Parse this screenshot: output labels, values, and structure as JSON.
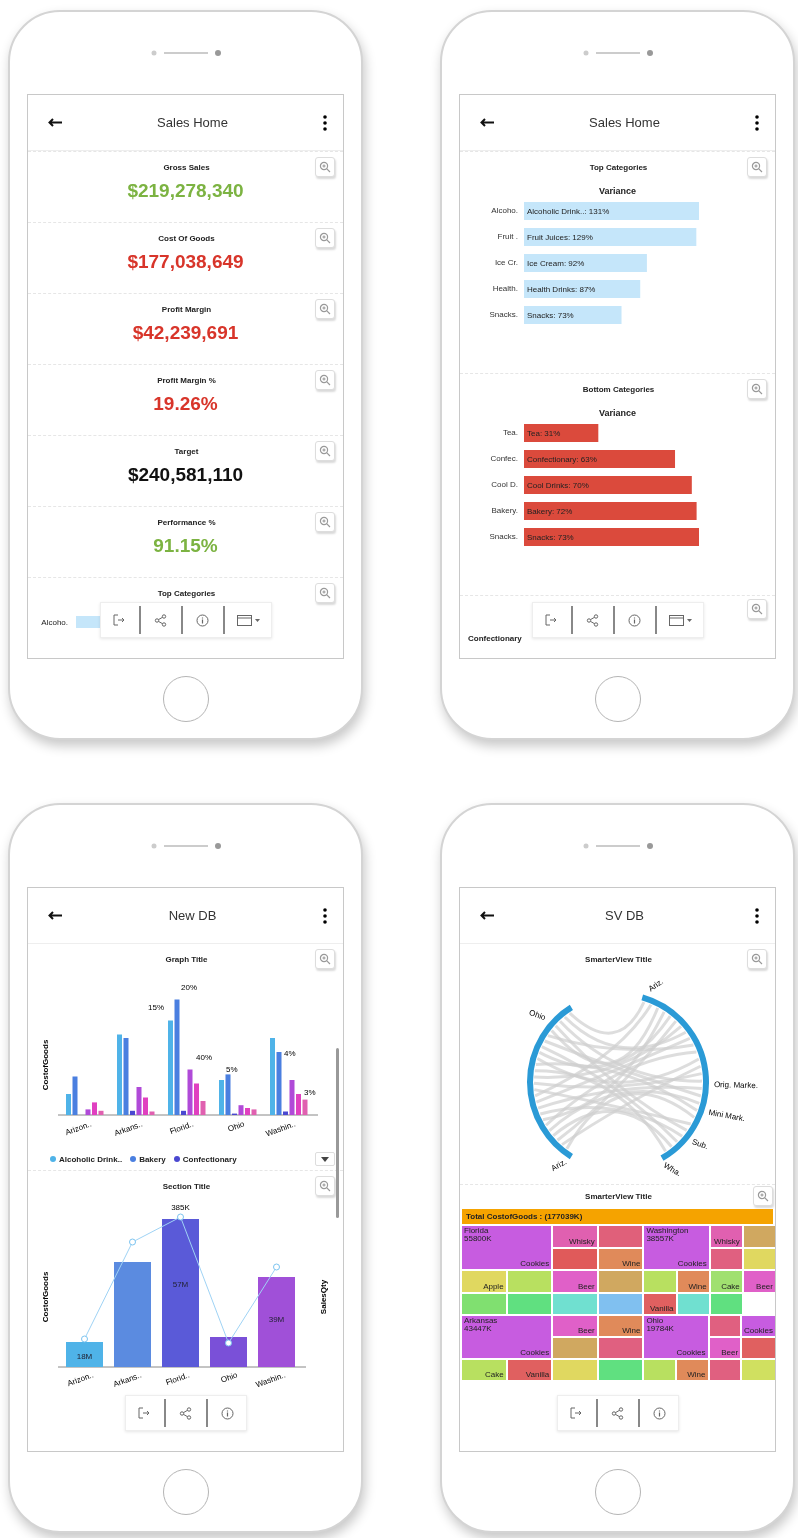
{
  "phones": [
    {
      "title": "Sales Home",
      "panels": [
        {
          "kind": "kpi",
          "label": "Gross Sales",
          "value": "$219,278,340",
          "color": "#7cb342"
        },
        {
          "kind": "kpi",
          "label": "Cost Of Goods",
          "value": "$177,038,649",
          "color": "#d8352a"
        },
        {
          "kind": "kpi",
          "label": "Profit Margin",
          "value": "$42,239,691",
          "color": "#d8352a"
        },
        {
          "kind": "kpi",
          "label": "Profit Margin %",
          "value": "19.26%",
          "color": "#d8352a"
        },
        {
          "kind": "kpi",
          "label": "Target",
          "value": "$240,581,110",
          "color": "#111111"
        },
        {
          "kind": "kpi",
          "label": "Performance %",
          "value": "91.15%",
          "color": "#7cb342"
        },
        {
          "kind": "peek",
          "title": "Top Categories",
          "category": "Alcoho."
        }
      ],
      "toolbar": [
        {
          "kind": "exit"
        },
        {
          "kind": "share"
        },
        {
          "kind": "info"
        },
        {
          "kind": "calendar"
        }
      ]
    },
    {
      "title": "Sales Home",
      "panels": [
        {
          "kind": "hbar",
          "title": "Top Categories",
          "color": "#c5e6fa",
          "chart_data": {
            "type": "bar",
            "orientation": "horizontal",
            "title": "Variance",
            "categories": [
              "Alcoho.",
              "Fruit .",
              "Ice Cr.",
              "Health.",
              "Snacks."
            ],
            "values": [
              131,
              129,
              92,
              87,
              73
            ],
            "value_labels": [
              "Alcoholic Drink..: 131%",
              "Fruit Juices: 129%",
              "Ice Cream: 92%",
              "Health Drinks: 87%",
              "Snacks: 73%"
            ]
          }
        },
        {
          "kind": "hbar",
          "title": "Bottom Categories",
          "color": "#db4a3c",
          "chart_data": {
            "type": "bar",
            "orientation": "horizontal",
            "title": "Variance",
            "categories": [
              "Tea.",
              "Confec.",
              "Cool D.",
              "Bakery.",
              "Snacks."
            ],
            "values": [
              31,
              63,
              70,
              72,
              73
            ],
            "value_labels": [
              "Tea: 31%",
              "Confectionary: 63%",
              "Cool Drinks: 70%",
              "Bakery: 72%",
              "Snacks: 73%"
            ]
          }
        },
        {
          "kind": "heading",
          "title": "Confectionary"
        }
      ],
      "toolbar": [
        {
          "kind": "exit"
        },
        {
          "kind": "share"
        },
        {
          "kind": "info"
        },
        {
          "kind": "calendar"
        }
      ]
    },
    {
      "title": "New DB",
      "panels": [
        {
          "kind": "columns",
          "title": "Graph Title",
          "ylabel": "CostofGoods",
          "categories": [
            "Arizon..",
            "Arkans..",
            "Florid..",
            "Ohio",
            "Washin.."
          ],
          "data_labels": [
            "20%",
            "15%",
            "40%",
            "5%",
            "4%",
            "3%"
          ],
          "legend": [
            {
              "label": "Alcoholic Drink..",
              "color": "#4fb3e8"
            },
            {
              "label": "Bakery",
              "color": "#4a7fe0"
            },
            {
              "label": "Confectionary",
              "color": "#4a48d0"
            }
          ]
        },
        {
          "kind": "combo",
          "title": "Section Title",
          "ylabel": "CostofGoods",
          "y2label": "SalesQty",
          "categories": [
            "Arizon..",
            "Arkans..",
            "Florid..",
            "Ohio",
            "Washin.."
          ],
          "bar_labels": [
            "18M",
            "57M",
            "39M"
          ],
          "point_label": "385K"
        }
      ],
      "toolbar": [
        {
          "kind": "exit"
        },
        {
          "kind": "share"
        },
        {
          "kind": "info"
        }
      ]
    },
    {
      "title": "SV DB",
      "panels": [
        {
          "kind": "chord",
          "title": "SmarterView Title",
          "labels": [
            "Ariz.",
            "Ohio",
            "Ariz.",
            "Orig. Marke.",
            "Mini Mark.",
            "Sub.",
            "Wha."
          ]
        },
        {
          "kind": "treemap",
          "title": "SmarterView Title",
          "total": "Total CostofGoods : (177039K)",
          "regions": [
            {
              "name": "Florida",
              "value": "55800K",
              "cells": [
                {
                  "label": "Cookies",
                  "color": "#c75ce0"
                },
                {
                  "label": "Whisky",
                  "color": "#e060b0"
                },
                {
                  "color": "#e0607a"
                },
                {
                  "color": "#e05a5a"
                },
                {
                  "label": "Wine",
                  "color": "#e08a5a"
                },
                {
                  "label": "Apple",
                  "color": "#e0d860"
                },
                {
                  "color": "#b8e060"
                },
                {
                  "label": "Beer",
                  "color": "#e060c8"
                },
                {
                  "color": "#d0a860"
                },
                {
                  "color": "#80e070"
                },
                {
                  "color": "#60e080"
                },
                {
                  "color": "#70e0d0"
                },
                {
                  "color": "#80c0f0"
                }
              ]
            },
            {
              "name": "Washington",
              "value": "38557K",
              "cells": [
                {
                  "label": "Cookies",
                  "color": "#c75ce0"
                },
                {
                  "label": "Whisky",
                  "color": "#e060b0"
                },
                {
                  "color": "#d0a860"
                },
                {
                  "color": "#e06080"
                },
                {
                  "color": "#e0d860"
                },
                {
                  "color": "#b8e060"
                },
                {
                  "label": "Wine",
                  "color": "#e08a5a"
                },
                {
                  "label": "Cake",
                  "color": "#a0e070"
                },
                {
                  "label": "Beer",
                  "color": "#e060c8"
                },
                {
                  "label": "Vanilla",
                  "color": "#e06060"
                },
                {
                  "color": "#70e0d0"
                },
                {
                  "color": "#60e080"
                }
              ]
            },
            {
              "name": "Arkansas",
              "value": "43447K",
              "cells": [
                {
                  "label": "Cookies",
                  "color": "#c75ce0"
                },
                {
                  "label": "Beer",
                  "color": "#e060c8"
                },
                {
                  "label": "Wine",
                  "color": "#e08a5a"
                },
                {
                  "color": "#d0a860"
                },
                {
                  "color": "#e06080"
                },
                {
                  "label": "Cake",
                  "color": "#b8e060"
                },
                {
                  "label": "Vanilla",
                  "color": "#e06060"
                },
                {
                  "color": "#e0d860"
                },
                {
                  "color": "#60e080"
                }
              ]
            },
            {
              "name": "Ohio",
              "value": "19784K",
              "cells": [
                {
                  "label": "Cookies",
                  "color": "#c75ce0"
                },
                {
                  "color": "#e06080"
                },
                {
                  "label": "Cookies",
                  "color": "#c75ce0"
                },
                {
                  "label": "Beer",
                  "color": "#e060c8"
                },
                {
                  "color": "#e06060"
                },
                {
                  "color": "#b8e060"
                },
                {
                  "label": "Wine",
                  "color": "#e08a5a"
                },
                {
                  "color": "#e06080"
                },
                {
                  "color": "#d0e060"
                }
              ]
            }
          ]
        }
      ],
      "toolbar": [
        {
          "kind": "exit"
        },
        {
          "kind": "share"
        },
        {
          "kind": "info"
        }
      ]
    }
  ]
}
